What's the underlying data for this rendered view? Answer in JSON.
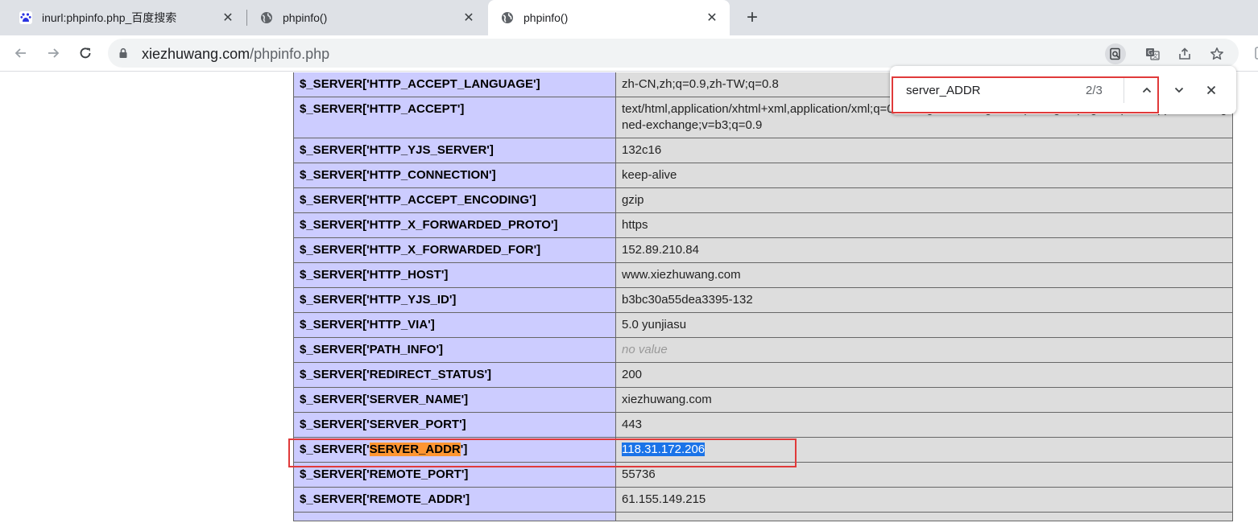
{
  "tabs": [
    {
      "title": "inurl:phpinfo.php_百度搜索",
      "icon": "baidu-icon"
    },
    {
      "title": "phpinfo()",
      "icon": "globe-icon"
    },
    {
      "title": "phpinfo()",
      "icon": "globe-icon"
    }
  ],
  "address": {
    "host": "xiezhuwang.com",
    "path": "/phpinfo.php"
  },
  "find": {
    "query": "server_ADDR",
    "count": "2/3"
  },
  "rows": [
    {
      "key": "$_SERVER['HTTP_ACCEPT_LANGUAGE']",
      "value": "zh-CN,zh;q=0.9,zh-TW;q=0.8"
    },
    {
      "key": "$_SERVER['HTTP_ACCEPT']",
      "value": "text/html,application/xhtml+xml,application/xml;q=0.9,image/avif,image/webp,image/apng,*/*;q=0.8,application/signed-exchange;v=b3;q=0.9"
    },
    {
      "key": "$_SERVER['HTTP_YJS_SERVER']",
      "value": "132c16"
    },
    {
      "key": "$_SERVER['HTTP_CONNECTION']",
      "value": "keep-alive"
    },
    {
      "key": "$_SERVER['HTTP_ACCEPT_ENCODING']",
      "value": "gzip"
    },
    {
      "key": "$_SERVER['HTTP_X_FORWARDED_PROTO']",
      "value": "https"
    },
    {
      "key": "$_SERVER['HTTP_X_FORWARDED_FOR']",
      "value": "152.89.210.84"
    },
    {
      "key": "$_SERVER['HTTP_HOST']",
      "value": "www.xiezhuwang.com"
    },
    {
      "key": "$_SERVER['HTTP_YJS_ID']",
      "value": "b3bc30a55dea3395-132"
    },
    {
      "key": "$_SERVER['HTTP_VIA']",
      "value": "5.0 yunjiasu"
    },
    {
      "key": "$_SERVER['PATH_INFO']",
      "value": "no value"
    },
    {
      "key": "$_SERVER['REDIRECT_STATUS']",
      "value": "200"
    },
    {
      "key": "$_SERVER['SERVER_NAME']",
      "value": "xiezhuwang.com"
    },
    {
      "key": "$_SERVER['SERVER_PORT']",
      "value": "443"
    },
    {
      "key_prefix": "$_SERVER['",
      "key_match": "SERVER_ADDR",
      "key_suffix": "']",
      "value": "118.31.172.206"
    },
    {
      "key": "$_SERVER['REMOTE_PORT']",
      "value": "55736"
    },
    {
      "key": "$_SERVER['REMOTE_ADDR']",
      "value": "61.155.149.215"
    },
    {
      "key": "",
      "value": ""
    }
  ],
  "colors": {
    "key_bg": "#ccccff",
    "value_bg": "#dddddd",
    "match_highlight": "#ff9632",
    "selection": "#1a73e8",
    "annotation_box": "#e03a3a"
  }
}
